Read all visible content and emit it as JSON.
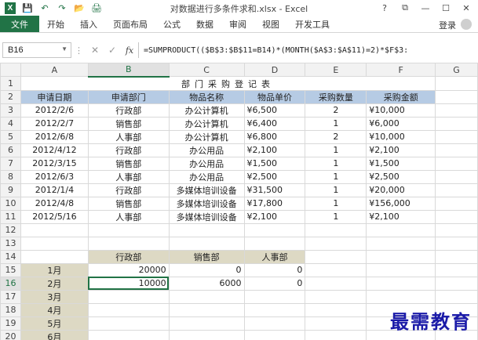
{
  "window": {
    "title": "对数据进行多条件求和.xlsx - Excel",
    "controls": [
      "?",
      "⧉",
      "—",
      "☐",
      "✕"
    ]
  },
  "quick_access": [
    "save-icon",
    "undo-icon",
    "redo-icon",
    "open-folder-icon",
    "print-icon"
  ],
  "ribbon": {
    "tabs": [
      "文件",
      "开始",
      "插入",
      "页面布局",
      "公式",
      "数据",
      "审阅",
      "视图",
      "开发工具"
    ],
    "login": "登录"
  },
  "formula_bar": {
    "name_box": "B16",
    "formula": "=SUMPRODUCT(($B$3:$B$11=B14)*(MONTH($A$3:$A$11)=2)*$F$3:"
  },
  "columns": [
    "A",
    "B",
    "C",
    "D",
    "E",
    "F",
    "G"
  ],
  "rows": [
    "1",
    "2",
    "3",
    "4",
    "5",
    "6",
    "7",
    "8",
    "9",
    "10",
    "11",
    "12",
    "13",
    "14",
    "15",
    "16",
    "17",
    "18",
    "19",
    "20"
  ],
  "sheet": {
    "title": "部门采购登记表",
    "headers": [
      "申请日期",
      "申请部门",
      "物品名称",
      "物品单价",
      "采购数量",
      "采购金额"
    ],
    "records": [
      [
        "2012/2/6",
        "行政部",
        "办公计算机",
        "¥6,500",
        "2",
        "¥10,000"
      ],
      [
        "2012/2/7",
        "销售部",
        "办公计算机",
        "¥6,400",
        "1",
        "¥6,000"
      ],
      [
        "2012/6/8",
        "人事部",
        "办公计算机",
        "¥6,800",
        "2",
        "¥10,000"
      ],
      [
        "2012/4/12",
        "行政部",
        "办公用品",
        "¥2,100",
        "1",
        "¥2,100"
      ],
      [
        "2012/3/15",
        "销售部",
        "办公用品",
        "¥1,500",
        "1",
        "¥1,500"
      ],
      [
        "2012/6/3",
        "人事部",
        "办公用品",
        "¥2,500",
        "1",
        "¥2,500"
      ],
      [
        "2012/1/4",
        "行政部",
        "多媒体培训设备",
        "¥31,500",
        "1",
        "¥20,000"
      ],
      [
        "2012/4/8",
        "销售部",
        "多媒体培训设备",
        "¥17,800",
        "1",
        "¥156,000"
      ],
      [
        "2012/5/16",
        "人事部",
        "多媒体培训设备",
        "¥2,100",
        "1",
        "¥2,100"
      ]
    ],
    "summary_headers": [
      "行政部",
      "销售部",
      "人事部"
    ],
    "summary_rows": [
      {
        "month": "1月",
        "values": [
          "20000",
          "0",
          "0"
        ]
      },
      {
        "month": "2月",
        "values": [
          "10000",
          "6000",
          "0"
        ]
      },
      {
        "month": "3月",
        "values": [
          "",
          "",
          ""
        ]
      },
      {
        "month": "4月",
        "values": [
          "",
          "",
          ""
        ]
      },
      {
        "month": "5月",
        "values": [
          "",
          "",
          ""
        ]
      },
      {
        "month": "6月",
        "values": [
          "",
          "",
          ""
        ]
      }
    ]
  },
  "watermark": "最需教育",
  "colors": {
    "accent": "#217346",
    "header_fill": "#b6cbe4",
    "summary_fill": "#ddd9c4"
  }
}
